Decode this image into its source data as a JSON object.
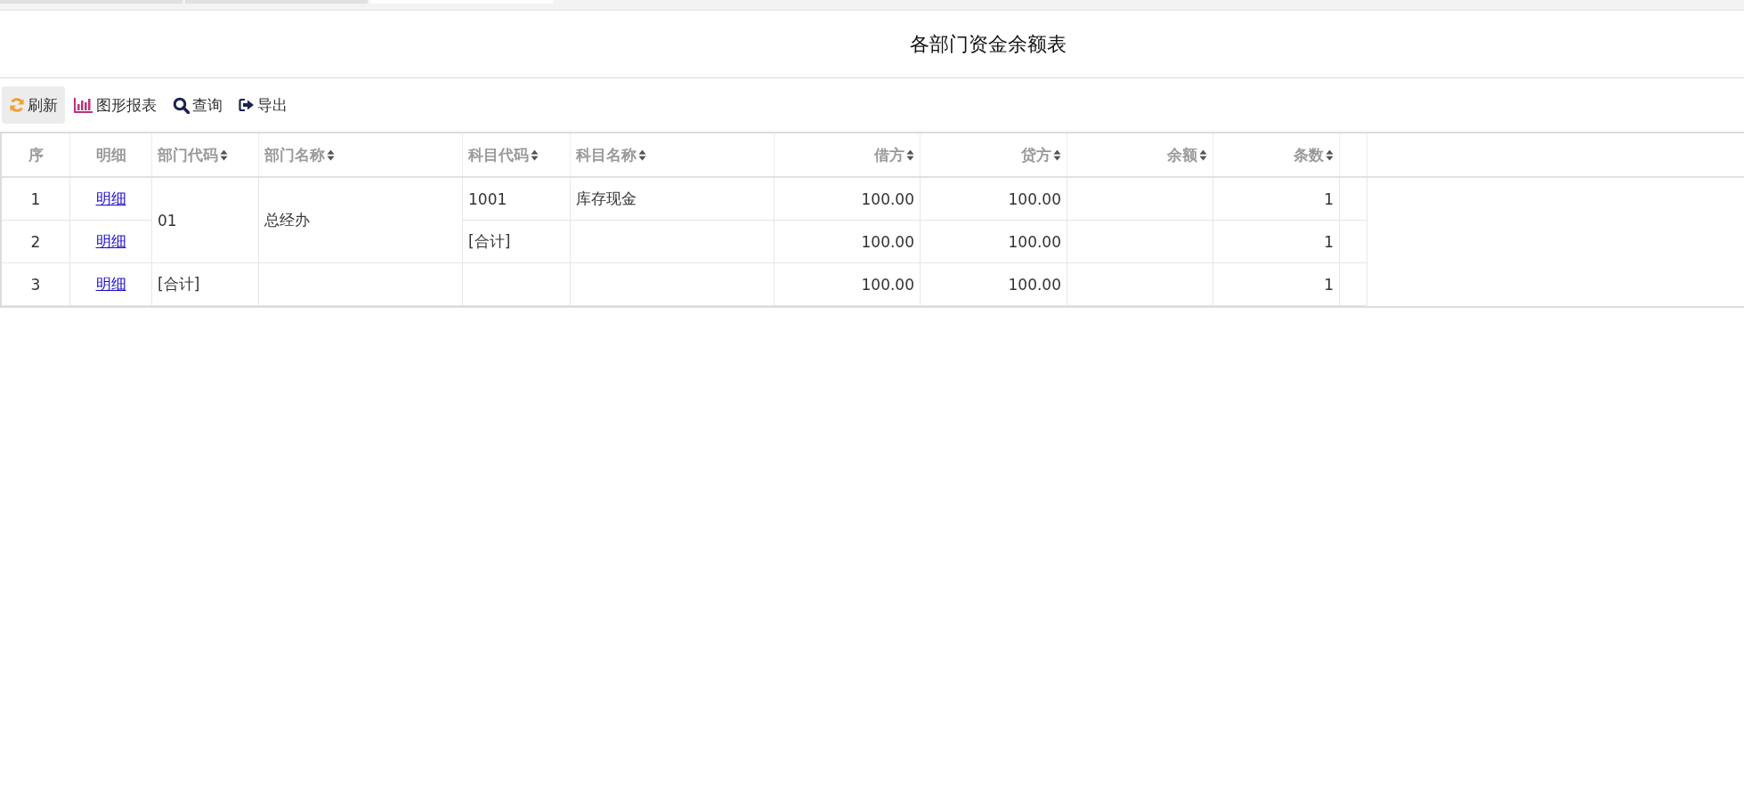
{
  "tabs": [
    {
      "selected": false
    },
    {
      "selected": false
    },
    {
      "selected": true
    }
  ],
  "title": "各部门资金余额表",
  "toolbar": [
    {
      "kind": "refresh",
      "label": "刷新",
      "selected": true
    },
    {
      "kind": "chart",
      "label": "图形报表",
      "selected": false
    },
    {
      "kind": "search",
      "label": "查询",
      "selected": false
    },
    {
      "kind": "export",
      "label": "导出",
      "selected": false
    }
  ],
  "table": {
    "columns": [
      {
        "label": "序",
        "sortable": false
      },
      {
        "label": "明细",
        "sortable": false
      },
      {
        "label": "部门代码",
        "sortable": true
      },
      {
        "label": "部门名称",
        "sortable": true
      },
      {
        "label": "科目代码",
        "sortable": true
      },
      {
        "label": "科目名称",
        "sortable": true
      },
      {
        "label": "借方",
        "sortable": true
      },
      {
        "label": "贷方",
        "sortable": true
      },
      {
        "label": "余额",
        "sortable": true
      },
      {
        "label": "条数",
        "sortable": true
      }
    ],
    "groups": [
      {
        "dept_code": "01",
        "dept_name": "总经办",
        "rows": [
          {
            "seq": "1",
            "detail": "明细",
            "subject_code": "1001",
            "subject_name": "库存现金",
            "debit": "100.00",
            "credit": "100.00",
            "count": "1"
          },
          {
            "seq": "2",
            "detail": "明细",
            "subject_code": "[合计]",
            "debit": "100.00",
            "credit": "100.00",
            "count": "1"
          }
        ]
      },
      {
        "dept_code": "[合计]",
        "rows": [
          {
            "seq": "3",
            "detail": "明细",
            "debit": "100.00",
            "credit": "100.00",
            "count": "1"
          }
        ]
      }
    ]
  }
}
